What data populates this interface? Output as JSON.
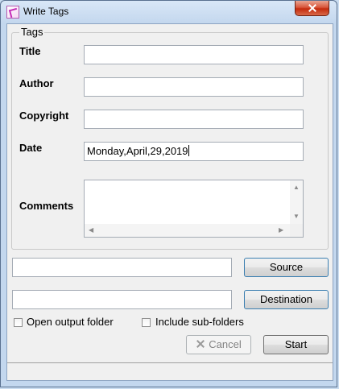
{
  "window": {
    "title": "Write Tags",
    "icon": "pen-tag-icon"
  },
  "tags_group": {
    "legend": "Tags",
    "title_label": "Title",
    "title_value": "",
    "author_label": "Author",
    "author_value": "",
    "copyright_label": "Copyright",
    "copyright_value": "",
    "date_label": "Date",
    "date_value": "Monday,April,29,2019",
    "comments_label": "Comments",
    "comments_value": ""
  },
  "source": {
    "path_value": "",
    "button_label": "Source"
  },
  "destination": {
    "path_value": "",
    "button_label": "Destination"
  },
  "options": {
    "open_output_folder_label": "Open output folder",
    "open_output_folder_checked": false,
    "include_subfolders_label": "Include sub-folders",
    "include_subfolders_checked": false
  },
  "actions": {
    "cancel_label": "Cancel",
    "cancel_enabled": false,
    "start_label": "Start"
  },
  "status": {
    "text": ""
  },
  "colors": {
    "titlebar": "#c3d7ee",
    "close_button": "#c42b0d",
    "focus_border": "#3c7fb1"
  }
}
